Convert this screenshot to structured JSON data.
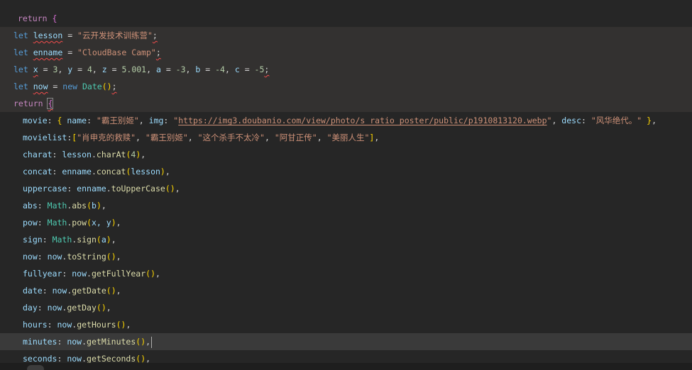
{
  "code": {
    "return_kw": "return",
    "open_brace": "{",
    "lesson": {
      "kw": "let",
      "name": "lesson",
      "op": " = ",
      "value": "\"云开发技术训练营\"",
      "end": ";"
    },
    "enname": {
      "kw": "let",
      "name": "enname",
      "op": " = ",
      "value": "\"CloudBase Camp\"",
      "end": ";"
    },
    "nums": {
      "kw": "let",
      "name": "x",
      "rest_a": " = ",
      "x": "3",
      "c1": ", ",
      "y_name": "y",
      "eq": " = ",
      "y": "4",
      "c2": ", ",
      "z_name": "z",
      "z": "5.001",
      "c3": ", ",
      "a_name": "a",
      "a": "-3",
      "c4": ", ",
      "b_name": "b",
      "b": "-4",
      "c5": ", ",
      "c_name": "c",
      "c": "-5",
      "end": ";"
    },
    "now": {
      "kw": "let",
      "name": "now",
      "op": " = ",
      "new_kw": "new",
      "ctor": "Date",
      "parens": "()",
      "end": ";"
    },
    "return2": {
      "kw": "return",
      "brace": "{"
    },
    "movie": {
      "key": "movie",
      "name_key": "name",
      "name_val": "\"霸王别姬\"",
      "img_key": "img",
      "img_q": "\"",
      "img_url": "https://img3.doubanio.com/view/photo/s_ratio_poster/public/p1910813120.webp",
      "desc_key": "desc",
      "desc_val": "\"风华绝代。\""
    },
    "movielist": {
      "key": "movielist",
      "items": [
        "\"肖申克的救赎\"",
        "\"霸王别姬\"",
        "\"这个杀手不太冷\"",
        "\"阿甘正传\"",
        "\"美丽人生\""
      ]
    },
    "props": [
      {
        "key": "charat",
        "obj": "lesson",
        "method": "charAt",
        "arg": "4",
        "arg_type": "num"
      },
      {
        "key": "concat",
        "obj": "enname",
        "method": "concat",
        "arg": "lesson",
        "arg_type": "var"
      },
      {
        "key": "uppercase",
        "obj": "enname",
        "method": "toUpperCase",
        "arg": "",
        "arg_type": "none"
      },
      {
        "key": "abs",
        "obj": "Math",
        "method": "abs",
        "arg": "b",
        "arg_type": "var",
        "math": true
      },
      {
        "key": "pow",
        "obj": "Math",
        "method": "pow",
        "arg": "x, y",
        "arg_type": "var",
        "math": true
      },
      {
        "key": "sign",
        "obj": "Math",
        "method": "sign",
        "arg": "a",
        "arg_type": "var",
        "math": true
      },
      {
        "key": "now",
        "obj": "now",
        "method": "toString",
        "arg": "",
        "arg_type": "none"
      },
      {
        "key": "fullyear",
        "obj": "now",
        "method": "getFullYear",
        "arg": "",
        "arg_type": "none"
      },
      {
        "key": "date",
        "obj": "now",
        "method": "getDate",
        "arg": "",
        "arg_type": "none"
      },
      {
        "key": "day",
        "obj": "now",
        "method": "getDay",
        "arg": "",
        "arg_type": "none"
      },
      {
        "key": "hours",
        "obj": "now",
        "method": "getHours",
        "arg": "",
        "arg_type": "none"
      },
      {
        "key": "minutes",
        "obj": "now",
        "method": "getMinutes",
        "arg": "",
        "arg_type": "none"
      },
      {
        "key": "seconds",
        "obj": "now",
        "method": "getSeconds",
        "arg": "",
        "arg_type": "none"
      }
    ]
  }
}
